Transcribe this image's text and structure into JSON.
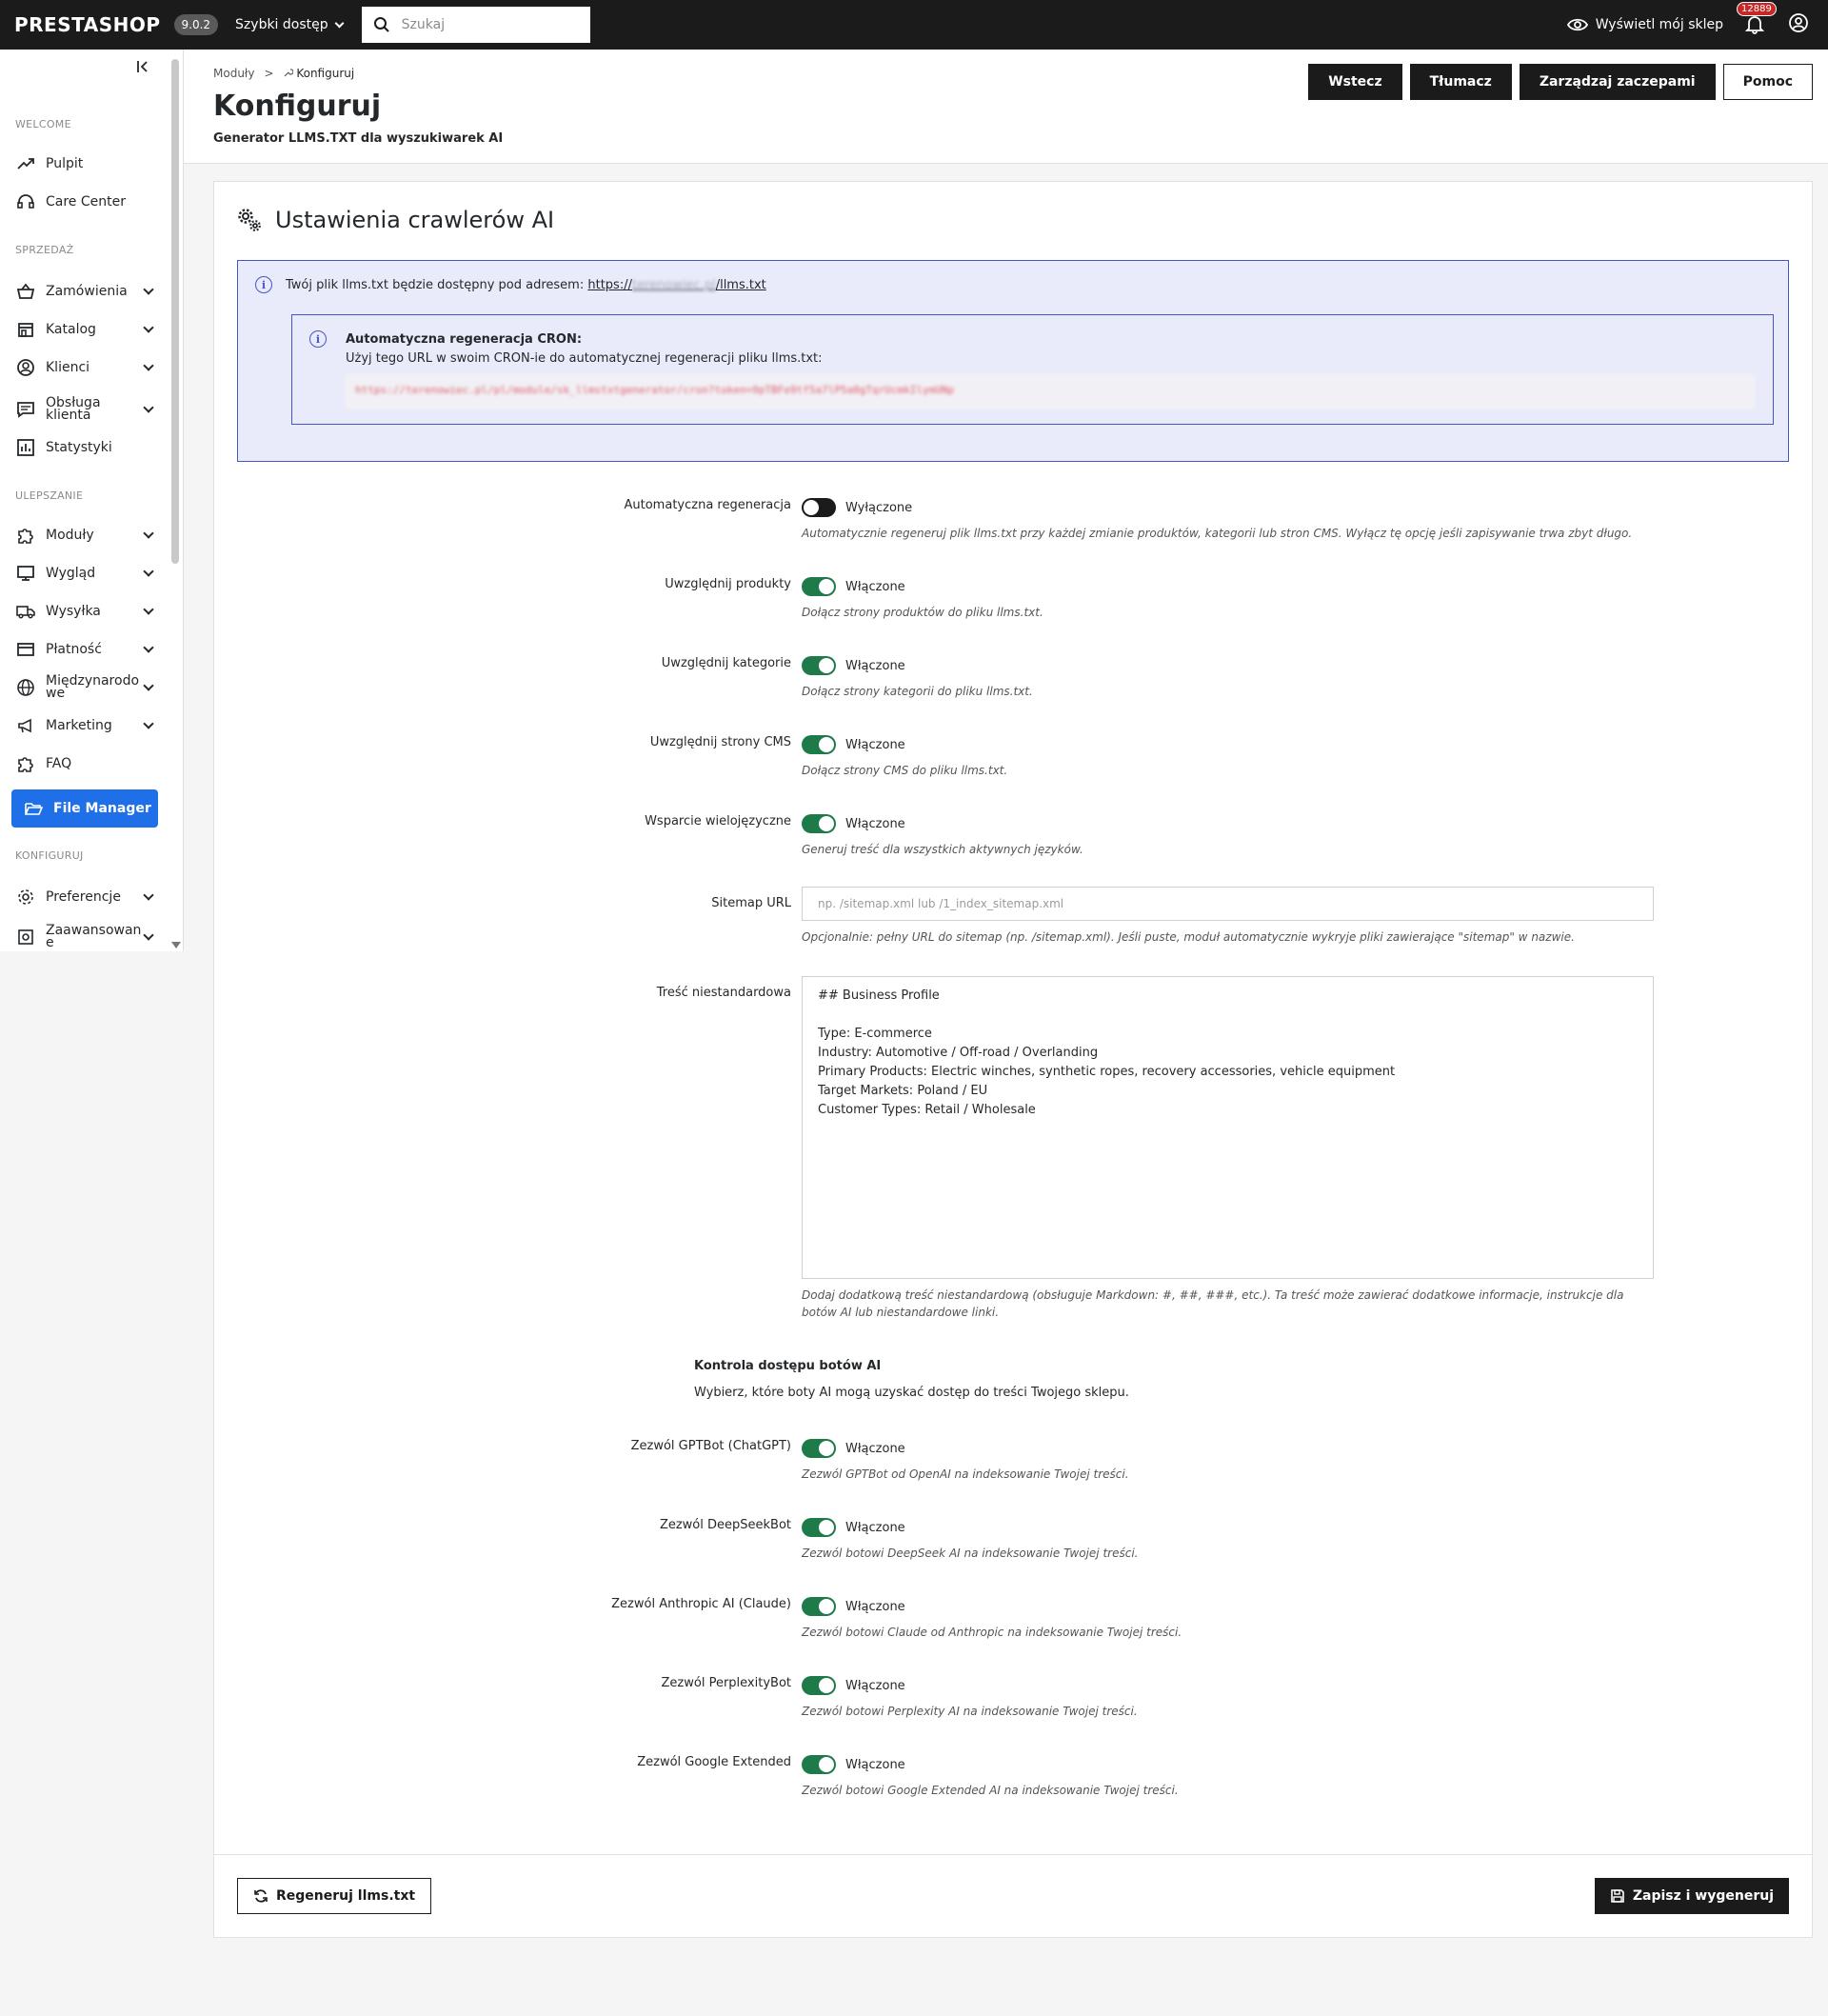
{
  "topbar": {
    "logo": "PRESTASHOP",
    "version": "9.0.2",
    "quick_access": "Szybki dostęp",
    "search_placeholder": "Szukaj",
    "view_shop": "Wyświetl mój sklep",
    "notifications_count": "12889"
  },
  "sidebar": {
    "sections": {
      "welcome": "WELCOME",
      "sales": "SPRZEDAŻ",
      "improve": "ULEPSZANIE",
      "configure": "KONFIGURUJ"
    },
    "items": {
      "dashboard": "Pulpit",
      "care_center": "Care Center",
      "orders": "Zamówienia",
      "catalog": "Katalog",
      "customers": "Klienci",
      "customer_service": "Obsługa klienta",
      "stats": "Statystyki",
      "modules": "Moduły",
      "design": "Wygląd",
      "shipping": "Wysyłka",
      "payment": "Płatność",
      "international": "Międzynarodowe",
      "marketing": "Marketing",
      "faq": "FAQ",
      "file_manager": "File Manager",
      "preferences": "Preferencje",
      "advanced": "Zaawansowane"
    }
  },
  "header": {
    "breadcrumb": [
      "Moduły",
      ">",
      "Konfiguruj"
    ],
    "title": "Konfiguruj",
    "subtitle": "Generator LLMS.TXT dla wyszukiwarek AI",
    "buttons": {
      "back": "Wstecz",
      "translate": "Tłumacz",
      "hooks": "Zarządzaj zaczepami",
      "help": "Pomoc"
    }
  },
  "card": {
    "title": "Ustawienia crawlerów AI",
    "info": {
      "text": "Twój plik llms.txt będzie dostępny pod adresem:",
      "url_prefix": "https://",
      "url_hidden": "terenowiec.pl",
      "url_suffix": "/llms.txt",
      "cron_title": "Automatyczna regeneracja CRON:",
      "cron_desc": "Użyj tego URL w swoim CRON-ie do automatycznej regeneracji pliku llms.txt:",
      "cron_url": "https://terenowiec.pl/pl/module/sk_llmstxtgenerator/cron?token=9pTBFe9tf5a7lP5a0gTqrUcmkIlymUNp"
    },
    "fields": {
      "auto_regen": {
        "label": "Automatyczna regeneracja",
        "state": "Wyłączone",
        "help": "Automatycznie regeneruj plik llms.txt przy każdej zmianie produktów, kategorii lub stron CMS. Wyłącz tę opcję jeśli zapisywanie trwa zbyt długo."
      },
      "include_products": {
        "label": "Uwzględnij produkty",
        "state": "Włączone",
        "help": "Dołącz strony produktów do pliku llms.txt."
      },
      "include_categories": {
        "label": "Uwzględnij kategorie",
        "state": "Włączone",
        "help": "Dołącz strony kategorii do pliku llms.txt."
      },
      "include_cms": {
        "label": "Uwzględnij strony CMS",
        "state": "Włączone",
        "help": "Dołącz strony CMS do pliku llms.txt."
      },
      "multilang": {
        "label": "Wsparcie wielojęzyczne",
        "state": "Włączone",
        "help": "Generuj treść dla wszystkich aktywnych języków."
      },
      "sitemap": {
        "label": "Sitemap URL",
        "placeholder": "np. /sitemap.xml lub /1_index_sitemap.xml",
        "help": "Opcjonalnie: pełny URL do sitemap (np. /sitemap.xml). Jeśli puste, moduł automatycznie wykryje pliki zawierające \"sitemap\" w nazwie."
      },
      "custom_content": {
        "label": "Treść niestandardowa",
        "lines": [
          "## Business Profile",
          "",
          "Type: E-commerce",
          "Industry: Automotive / Off-road / Overlanding",
          "Primary Products: Electric winches, synthetic ropes, recovery accessories, vehicle equipment",
          "Target Markets: Poland / EU",
          "Customer Types: Retail / Wholesale"
        ],
        "help": "Dodaj dodatkową treść niestandardową (obsługuje Markdown: #, ##, ###, etc.). Ta treść może zawierać dodatkowe informacje, instrukcje dla botów AI lub niestandardowe linki."
      }
    },
    "bots_section": {
      "title": "Kontrola dostępu botów AI",
      "desc": "Wybierz, które boty AI mogą uzyskać dostęp do treści Twojego sklepu."
    },
    "bots": {
      "gptbot": {
        "label": "Zezwól GPTBot (ChatGPT)",
        "state": "Włączone",
        "help": "Zezwól GPTBot od OpenAI na indeksowanie Twojej treści."
      },
      "deepseek": {
        "label": "Zezwól DeepSeekBot",
        "state": "Włączone",
        "help": "Zezwól botowi DeepSeek AI na indeksowanie Twojej treści."
      },
      "anthropic": {
        "label": "Zezwól Anthropic AI (Claude)",
        "state": "Włączone",
        "help": "Zezwól botowi Claude od Anthropic na indeksowanie Twojej treści."
      },
      "perplexity": {
        "label": "Zezwól PerplexityBot",
        "state": "Włączone",
        "help": "Zezwól botowi Perplexity AI na indeksowanie Twojej treści."
      },
      "google": {
        "label": "Zezwól Google Extended",
        "state": "Włączone",
        "help": "Zezwól botowi Google Extended AI na indeksowanie Twojej treści."
      }
    },
    "footer": {
      "regenerate": "Regeneruj llms.txt",
      "save": "Zapisz i wygeneruj"
    }
  }
}
